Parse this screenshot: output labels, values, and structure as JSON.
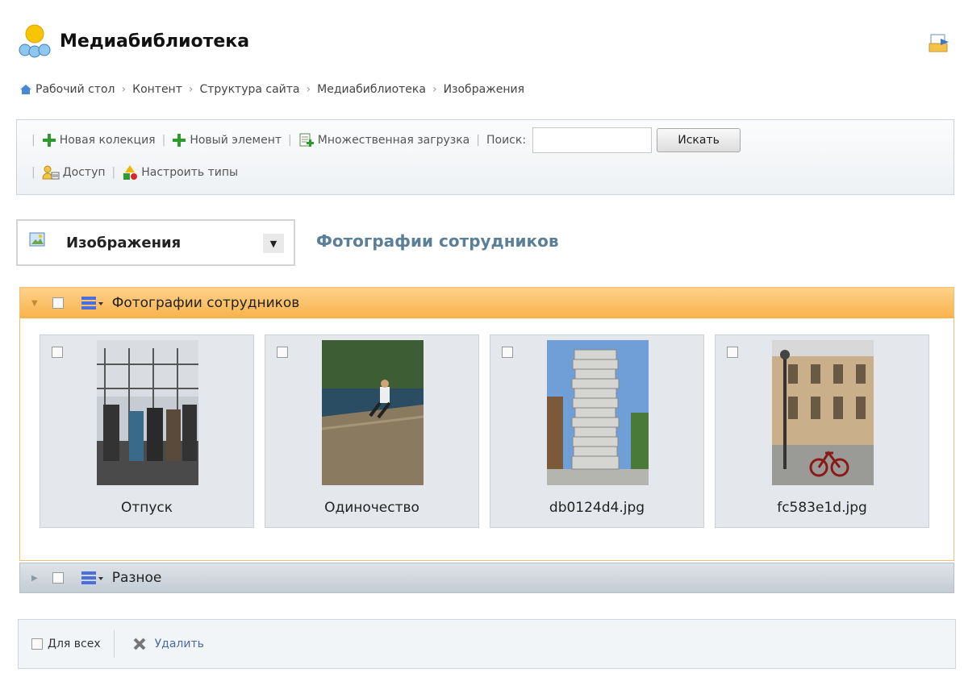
{
  "title": "Медиабиблиотека",
  "breadcrumbs": [
    "Рабочий стол",
    "Контент",
    "Структура сайта",
    "Медиабиблиотека",
    "Изображения"
  ],
  "toolbar": {
    "new_collection": "Новая колекция",
    "new_element": "Новый элемент",
    "bulk_upload": "Множественная загрузка",
    "search_label": "Поиск:",
    "search_value": "",
    "search_button": "Искать",
    "access": "Доступ",
    "configure_types": "Настроить типы"
  },
  "type_select": {
    "selected": "Изображения"
  },
  "collection_heading": "Фотографии сотрудников",
  "collections": [
    {
      "name": "Фотографии сотрудников",
      "expanded": true,
      "items": [
        {
          "caption": "Отпуск"
        },
        {
          "caption": "Одиночество"
        },
        {
          "caption": "db0124d4.jpg"
        },
        {
          "caption": "fc583e1d.jpg"
        }
      ]
    },
    {
      "name": "Разное",
      "expanded": false
    }
  ],
  "footer": {
    "for_all": "Для всех",
    "delete": "Удалить"
  },
  "colors": {
    "accent_header": "#f8b24c",
    "heading_blue": "#5a7f98",
    "icon_green": "#2e9b2e"
  }
}
